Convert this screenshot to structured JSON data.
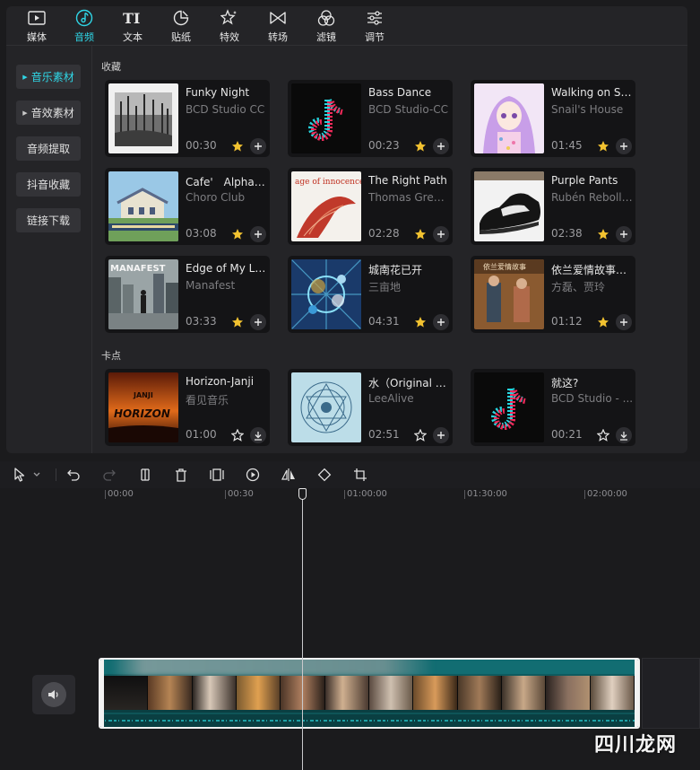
{
  "colors": {
    "accent": "#2fd6e6",
    "star": "#f2c230",
    "panel": "#242427",
    "card": "#141416",
    "clip": "#0e5b5f"
  },
  "top_tabs": [
    {
      "label": "媒体",
      "icon": "media-icon"
    },
    {
      "label": "音频",
      "icon": "audio-icon",
      "active": true
    },
    {
      "label": "文本",
      "icon": "text-icon"
    },
    {
      "label": "贴纸",
      "icon": "sticker-icon"
    },
    {
      "label": "特效",
      "icon": "effects-icon"
    },
    {
      "label": "转场",
      "icon": "transition-icon"
    },
    {
      "label": "滤镜",
      "icon": "filter-icon"
    },
    {
      "label": "调节",
      "icon": "adjust-icon"
    }
  ],
  "left_nav": [
    {
      "label": "音乐素材",
      "active": true,
      "has_arrow": true
    },
    {
      "label": "音效素材",
      "has_arrow": true
    },
    {
      "label": "音频提取"
    },
    {
      "label": "抖音收藏"
    },
    {
      "label": "链接下载"
    }
  ],
  "sections": {
    "favorites": "收藏",
    "beat": "卡点"
  },
  "favorites": [
    {
      "title": "Funky Night",
      "artist": "BCD Studio CC",
      "duration": "00:30",
      "starred": true,
      "cover": "forest"
    },
    {
      "title": "Bass Dance",
      "artist": "BCD Studio-CC",
      "duration": "00:23",
      "starred": true,
      "cover": "tiktok"
    },
    {
      "title": "Walking on Sn...",
      "artist": "Snail's House",
      "duration": "01:45",
      "starred": true,
      "cover": "anime"
    },
    {
      "title": "Cafe'　Alpha(...",
      "artist": "Choro Club",
      "duration": "03:08",
      "starred": true,
      "cover": "house"
    },
    {
      "title": "The Right Path",
      "artist": "Thomas Green...",
      "duration": "02:28",
      "starred": true,
      "cover": "innocence",
      "cover_text": "age of innocence"
    },
    {
      "title": "Purple Pants",
      "artist": "Rubén Rebolle...",
      "duration": "02:38",
      "starred": true,
      "cover": "shoe"
    },
    {
      "title": "Edge of My Life",
      "artist": "Manafest",
      "duration": "03:33",
      "starred": true,
      "cover": "city",
      "cover_text": "MANAFEST"
    },
    {
      "title": "城南花已开",
      "artist": "三亩地",
      "duration": "04:31",
      "starred": true,
      "cover": "blue"
    },
    {
      "title": "依兰爱情故事（...",
      "artist": "方磊、贾玲",
      "duration": "01:12",
      "starred": true,
      "cover": "poster"
    }
  ],
  "beat_tracks": [
    {
      "title": "Horizon-Janji",
      "artist": "看见音乐",
      "duration": "01:00",
      "starred": false,
      "download": true,
      "cover": "horizon",
      "cover_text": "HORIZON",
      "cover_text2": "JANJI"
    },
    {
      "title": "水（Original M...",
      "artist": "LeeAlive",
      "duration": "02:51",
      "starred": false,
      "download": false,
      "cover": "mandala"
    },
    {
      "title": "就这?",
      "artist": "BCD Studio - ...",
      "duration": "00:21",
      "starred": false,
      "download": true,
      "cover": "tiktok"
    }
  ],
  "toolbar": {
    "tools": [
      "select-icon",
      "dropdown-icon",
      "undo-icon",
      "redo-icon",
      "split-icon",
      "delete-icon",
      "freeze-icon",
      "play-circle-icon",
      "mirror-icon",
      "rotate-icon",
      "crop-icon"
    ]
  },
  "ruler": {
    "ticks": [
      "00:00",
      "00:30",
      "01:00:00",
      "01:30:00",
      "02:00:00"
    ]
  },
  "watermark": "四川龙网"
}
